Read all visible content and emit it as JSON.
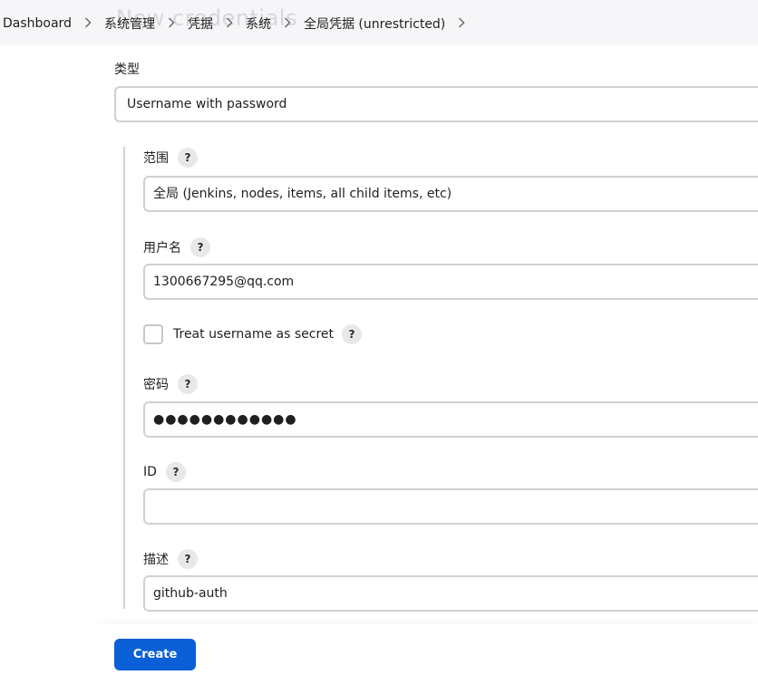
{
  "page": {
    "background_title": "New credentials"
  },
  "breadcrumb": {
    "items": [
      {
        "label": "Dashboard"
      },
      {
        "label": "系统管理"
      },
      {
        "label": "凭据"
      },
      {
        "label": "系统"
      },
      {
        "label": "全局凭据 (unrestricted)"
      }
    ]
  },
  "form": {
    "type_label": "类型",
    "type_value": "Username with password",
    "scope_label": "范围",
    "scope_value": "全局 (Jenkins, nodes, items, all child items, etc)",
    "username_label": "用户名",
    "username_value": "1300667295@qq.com",
    "treat_secret_label": "Treat username as secret",
    "treat_secret_checked": false,
    "password_label": "密码",
    "password_mask": "●●●●●●●●●●●●",
    "id_label": "ID",
    "id_value": "",
    "description_label": "描述",
    "description_value": "github-auth",
    "help_symbol": "?"
  },
  "actions": {
    "create_label": "Create",
    "create_color": "#0a5fd6"
  }
}
